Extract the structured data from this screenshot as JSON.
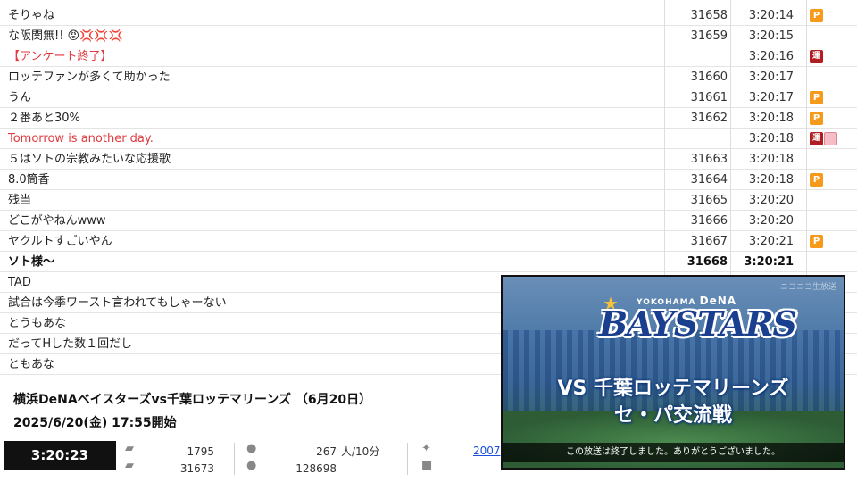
{
  "comments": [
    {
      "text": "そりゃね",
      "num": "31658",
      "time": "3:20:14",
      "badge": "P",
      "style": ""
    },
    {
      "text": "な阪関無!! 😡💢💢💢",
      "num": "31659",
      "time": "3:20:15",
      "badge": "",
      "style": ""
    },
    {
      "text": "【アンケート終了】",
      "num": "",
      "time": "3:20:16",
      "badge": "運",
      "style": "red"
    },
    {
      "text": "ロッテファンが多くて助かった",
      "num": "31660",
      "time": "3:20:17",
      "badge": "",
      "style": ""
    },
    {
      "text": "うん",
      "num": "31661",
      "time": "3:20:17",
      "badge": "P",
      "style": ""
    },
    {
      "text": "２番あと30%",
      "num": "31662",
      "time": "3:20:18",
      "badge": "P",
      "style": ""
    },
    {
      "text": "Tomorrow is another day.",
      "num": "",
      "time": "3:20:18",
      "badge": "運",
      "style": "red"
    },
    {
      "text": "５はソトの宗教みたいな応援歌",
      "num": "31663",
      "time": "3:20:18",
      "badge": "",
      "style": ""
    },
    {
      "text": "8.0筒香",
      "num": "31664",
      "time": "3:20:18",
      "badge": "P",
      "style": ""
    },
    {
      "text": "残当",
      "num": "31665",
      "time": "3:20:20",
      "badge": "",
      "style": ""
    },
    {
      "text": "どこがやねんwww",
      "num": "31666",
      "time": "3:20:20",
      "badge": "",
      "style": ""
    },
    {
      "text": "ヤクルトすごいやん",
      "num": "31667",
      "time": "3:20:21",
      "badge": "P",
      "style": ""
    },
    {
      "text": "ソト様〜",
      "num": "31668",
      "time": "3:20:21",
      "badge": "",
      "style": "bold"
    },
    {
      "text": "TAD",
      "num": "",
      "time": "",
      "badge": "",
      "style": ""
    },
    {
      "text": "試合は今季ワースト言われてもしゃーない",
      "num": "",
      "time": "",
      "badge": "",
      "style": ""
    },
    {
      "text": "とうもあな",
      "num": "",
      "time": "",
      "badge": "",
      "style": ""
    },
    {
      "text": "だってHした数１回だし",
      "num": "",
      "time": "",
      "badge": "",
      "style": ""
    },
    {
      "text": "ともあな",
      "num": "",
      "time": "",
      "badge": "",
      "style": ""
    }
  ],
  "info": {
    "title": "横浜DeNAベイスターズvs千葉ロッテマリーンズ （6月20日）",
    "datetime": "2025/6/20(金) 17:55開始"
  },
  "status": {
    "clock": "3:20:23",
    "comments_per": "1795",
    "comments_total": "31673",
    "viewers_now": "267",
    "viewers_unit": "人/10分",
    "viewers_total": "128698",
    "link": "2007"
  },
  "video": {
    "watermark": "ニコニコ生放送",
    "logo_small_prefix": "YOKOHAMA",
    "logo_small_brand": "DeNA",
    "logo_big": "BAYSTARS",
    "matchup": "VS 千葉ロッテマリーンズ",
    "series": "セ・パ交流戦",
    "end_message": "この放送は終了しました。ありがとうございました。"
  },
  "colors": {
    "badge_premium": "#f59a1b",
    "badge_operator": "#b11e22",
    "operator_text": "#e0393e",
    "clock_bg": "#111111"
  }
}
